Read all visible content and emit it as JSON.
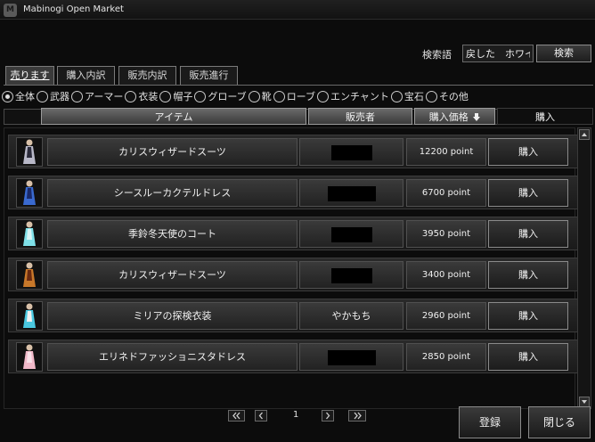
{
  "window": {
    "title": "Mabinogi Open Market",
    "logo_text": "M"
  },
  "search": {
    "label": "検索語",
    "value": "戻した　ホワイ",
    "button": "検索"
  },
  "tabs": [
    {
      "label": "売ります",
      "active": true
    },
    {
      "label": "購入内訳",
      "active": false
    },
    {
      "label": "販売内訳",
      "active": false
    },
    {
      "label": "販売進行",
      "active": false
    }
  ],
  "filters": [
    {
      "label": "全体",
      "selected": true
    },
    {
      "label": "武器",
      "selected": false
    },
    {
      "label": "アーマー",
      "selected": false
    },
    {
      "label": "衣装",
      "selected": false
    },
    {
      "label": "帽子",
      "selected": false
    },
    {
      "label": "グローブ",
      "selected": false
    },
    {
      "label": "靴",
      "selected": false
    },
    {
      "label": "ローブ",
      "selected": false
    },
    {
      "label": "エンチャント",
      "selected": false
    },
    {
      "label": "宝石",
      "selected": false
    },
    {
      "label": "その他",
      "selected": false
    }
  ],
  "columns": {
    "item": "アイテム",
    "seller": "販売者",
    "price": "購入価格",
    "price_sort_icon": "arrow-down-icon",
    "buy": "購入"
  },
  "rows": [
    {
      "name": "カリスウィザードスーツ",
      "seller": "",
      "seller_hidden": true,
      "price": "12200 point",
      "buy": "購入",
      "thumb": "dark-robe-costume",
      "thumb_colors": [
        "#b8b8c8",
        "#2a2a3a"
      ]
    },
    {
      "name": "シースルーカクテルドレス",
      "seller": "",
      "seller_hidden": true,
      "price": "6700 point",
      "buy": "購入",
      "thumb": "blue-cocktail-dress",
      "thumb_colors": [
        "#3a6ad0",
        "#1a2a6a"
      ]
    },
    {
      "name": "季鈴冬天使のコート",
      "seller": "",
      "seller_hidden": true,
      "price": "3950 point",
      "buy": "購入",
      "thumb": "cyan-winter-coat",
      "thumb_colors": [
        "#7fe0e8",
        "#d8f4f6"
      ]
    },
    {
      "name": "カリスウィザードスーツ",
      "seller": "",
      "seller_hidden": true,
      "price": "3400 point",
      "buy": "購入",
      "thumb": "orange-robe-costume",
      "thumb_colors": [
        "#c8782a",
        "#6a2a10"
      ]
    },
    {
      "name": "ミリアの探検衣装",
      "seller": "やかもち",
      "seller_hidden": false,
      "price": "2960 point",
      "buy": "購入",
      "thumb": "explorer-outfit",
      "thumb_colors": [
        "#4ac8e0",
        "#f0f0f0"
      ]
    },
    {
      "name": "エリネドファッショニスタドレス",
      "seller": "",
      "seller_hidden": true,
      "price": "2850 point",
      "buy": "購入",
      "thumb": "pink-fashion-dress",
      "thumb_colors": [
        "#f0b8c8",
        "#f8e0e8"
      ]
    }
  ],
  "pagination": {
    "current_page": "1",
    "first_icon": "double-chevron-left-icon",
    "prev_icon": "chevron-left-icon",
    "next_icon": "chevron-right-icon",
    "last_icon": "double-chevron-right-icon"
  },
  "footer": {
    "register": "登録",
    "close": "閉じる"
  }
}
